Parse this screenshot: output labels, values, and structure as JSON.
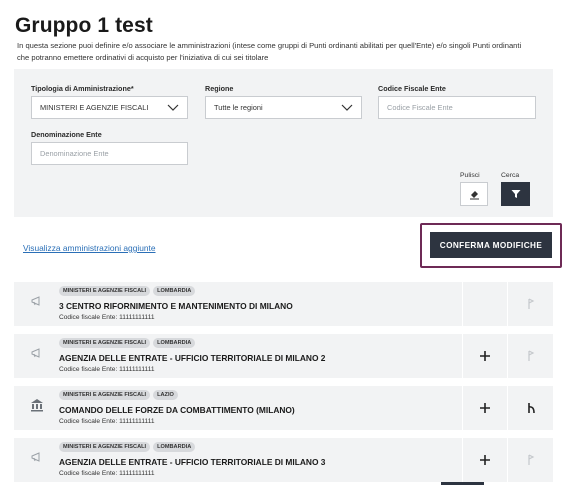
{
  "page": {
    "title": "Gruppo 1 test",
    "description": "In questa sezione puoi definire e/o associare le amministrazioni (intese come gruppi di Punti ordinanti abilitati per quell'Ente) e/o singoli Punti ordinanti che potranno emettere ordinativi di acquisto per l'iniziativa di cui sei titolare"
  },
  "filters": {
    "tipologia": {
      "label": "Tipologia di Amministrazione*",
      "value": "MINISTERI E AGENZIE FISCALI"
    },
    "regione": {
      "label": "Regione",
      "value": "Tutte le regioni"
    },
    "codice_fiscale": {
      "label": "Codice Fiscale Ente",
      "placeholder": "Codice Fiscale Ente"
    },
    "denominazione": {
      "label": "Denominazione Ente",
      "placeholder": "Denominazione Ente"
    },
    "clean_label": "Pulisci",
    "search_label": "Cerca"
  },
  "link_more": "Visualizza amministrazioni aggiunte",
  "confirm_button": "CONFERMA MODIFICHE",
  "items": [
    {
      "badges": [
        "MINISTERI E AGENZIE FISCALI",
        "LOMBARDIA"
      ],
      "name": "3 CENTRO RIFORNIMENTO E MANTENIMENTO DI MILANO",
      "cf": "Codice fiscale Ente: 11111111111",
      "icon": "megaphone-icon",
      "add": ""
    },
    {
      "badges": [
        "MINISTERI E AGENZIE FISCALI",
        "LOMBARDIA"
      ],
      "name": "AGENZIA DELLE ENTRATE - UFFICIO TERRITORIALE DI MILANO 2",
      "cf": "Codice fiscale Ente: 11111111111",
      "icon": "megaphone-icon",
      "add": "+"
    },
    {
      "badges": [
        "MINISTERI E AGENZIE FISCALI",
        "LAZIO"
      ],
      "name": "COMANDO DELLE FORZE DA COMBATTIMENTO (MILANO)",
      "cf": "Codice fiscale Ente: 11111111111",
      "icon": "institution-icon",
      "add": "+"
    },
    {
      "badges": [
        "MINISTERI E AGENZIE FISCALI",
        "LOMBARDIA"
      ],
      "name": "AGENZIA DELLE ENTRATE - UFFICIO TERRITORIALE DI MILANO 3",
      "cf": "Codice fiscale Ente: 11111111111",
      "icon": "megaphone-icon",
      "add": "+"
    }
  ],
  "colors": {
    "primary_dark": "#2d3440",
    "highlight_frame": "#6e2a56",
    "link": "#2a6fb7",
    "panel": "#f2f3f4"
  }
}
